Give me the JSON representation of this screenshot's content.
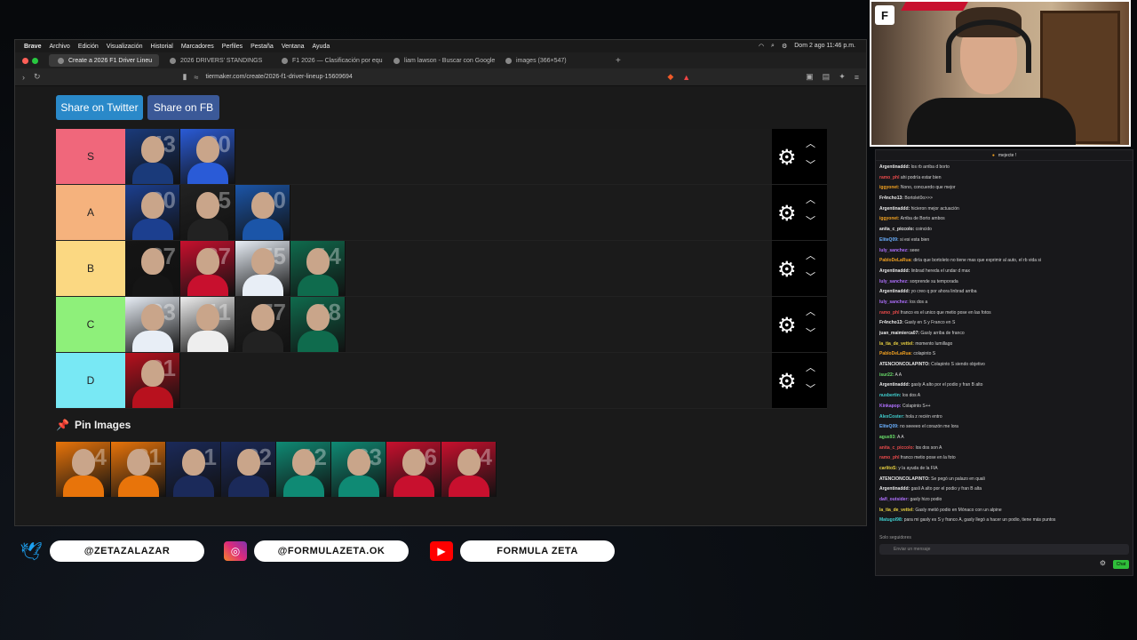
{
  "menubar": {
    "items": [
      "Brave",
      "Archivo",
      "Edición",
      "Visualización",
      "Historial",
      "Marcadores",
      "Perfiles",
      "Pestaña",
      "Ventana",
      "Ayuda"
    ],
    "clock": "Dom 2 ago 11:46 p.m."
  },
  "tabs": [
    {
      "label": "Create a 2026 F1 Driver Lineu"
    },
    {
      "label": "2026 DRIVERS' STANDINGS"
    },
    {
      "label": "F1 2026 — Clasificación por equip"
    },
    {
      "label": "liam lawson - Buscar con Google"
    },
    {
      "label": "images (366×547)"
    }
  ],
  "address": {
    "url": "tiermaker.com/create/2026-f1-driver-lineup-15609694"
  },
  "share": {
    "twitter": "Share on Twitter",
    "facebook": "Share on FB"
  },
  "tiers": [
    {
      "label": "S",
      "color": "#f0677b",
      "drivers": [
        {
          "num": "43",
          "kit": "#1a3a7a"
        },
        {
          "num": "30",
          "kit": "#2a5bd7"
        }
      ]
    },
    {
      "label": "A",
      "color": "#f5b27d",
      "drivers": [
        {
          "num": "30",
          "kit": "#1c3f8f"
        },
        {
          "num": "5",
          "kit": "#222"
        },
        {
          "num": "10",
          "kit": "#1b55a8"
        }
      ]
    },
    {
      "label": "B",
      "color": "#fbd882",
      "drivers": [
        {
          "num": "27",
          "kit": "#151515"
        },
        {
          "num": "87",
          "kit": "#c8102e"
        },
        {
          "num": "55",
          "kit": "#e8eef6"
        },
        {
          "num": "14",
          "kit": "#0f6b4d"
        }
      ]
    },
    {
      "label": "C",
      "color": "#8ef07a",
      "drivers": [
        {
          "num": "23",
          "kit": "#e8eef6"
        },
        {
          "num": "11",
          "kit": "#eeeeee"
        },
        {
          "num": "77",
          "kit": "#222"
        },
        {
          "num": "18",
          "kit": "#0f6b4d"
        }
      ]
    },
    {
      "label": "D",
      "color": "#78e8f4",
      "drivers": [
        {
          "num": "31",
          "kit": "#b8111e"
        }
      ]
    }
  ],
  "pin": {
    "title": "Pin Images"
  },
  "pin_images": [
    {
      "num": "4",
      "kit": "#e8740a"
    },
    {
      "num": "81",
      "kit": "#e8740a"
    },
    {
      "num": "1",
      "kit": "#1b2a5a"
    },
    {
      "num": "22",
      "kit": "#1b2a5a"
    },
    {
      "num": "12",
      "kit": "#0f8a74"
    },
    {
      "num": "63",
      "kit": "#0f8a74"
    },
    {
      "num": "16",
      "kit": "#c8102e"
    },
    {
      "num": "44",
      "kit": "#c8102e"
    }
  ],
  "chat": {
    "pinned": "mejecte !",
    "messages": [
      {
        "user": "Argentinaddd:",
        "color": "#e8e8e8",
        "text": "los rb arriba d borto"
      },
      {
        "user": "ramo_phl",
        "color": "#e84a4a",
        "text": "ahi podría estar bien"
      },
      {
        "user": "iggyonet:",
        "color": "#f0a020",
        "text": "Nono, concuerdo que mejor"
      },
      {
        "user": "Fr4ncho13:",
        "color": "#e8e8e8",
        "text": "Bortolet0o>>>"
      },
      {
        "user": "Argentinaddd:",
        "color": "#e8e8e8",
        "text": "hicieron mejor actuación"
      },
      {
        "user": "iggyonet:",
        "color": "#f0a020",
        "text": "Arriba de Borto ambos"
      },
      {
        "user": "anita_c_piccolo:",
        "color": "#e8e8e8",
        "text": "coincido"
      },
      {
        "user": "EliteQ09:",
        "color": "#6ab0ff",
        "text": "si esi esta bien"
      },
      {
        "user": "luly_sanchez:",
        "color": "#b070ff",
        "text": "seee"
      },
      {
        "user": "PabloDeLaRua:",
        "color": "#f0a020",
        "text": "diría que bortoleto no tiene mas que exprimir al auto, el rb vida si"
      },
      {
        "user": "Argentinaddd:",
        "color": "#e8e8e8",
        "text": "linbrad hereda el undar d max"
      },
      {
        "user": "luly_sanchez:",
        "color": "#b070ff",
        "text": "sorprende su temporada"
      },
      {
        "user": "Argentinaddd:",
        "color": "#e8e8e8",
        "text": "yo creo q por ahora linbrad arriba"
      },
      {
        "user": "luly_sanchez:",
        "color": "#b070ff",
        "text": "los dos a"
      },
      {
        "user": "ramo_phl",
        "color": "#e84a4a",
        "text": "franco es el unico que metio pose en las fotos"
      },
      {
        "user": "Fr4ncho13:",
        "color": "#e8e8e8",
        "text": "Gasly en S y Franco en S"
      },
      {
        "user": "juan_maimierca07:",
        "color": "#e8e8e8",
        "text": "Gasly arriba de franco"
      },
      {
        "user": "la_tia_de_vettel:",
        "color": "#e8d040",
        "text": "momento lumillago"
      },
      {
        "user": "PabloDeLaRua:",
        "color": "#f0a020",
        "text": "colapinto S"
      },
      {
        "user": "ATENCIONCOLAPINTO:",
        "color": "#e8e8e8",
        "text": "Colapinto S siendo objetivo"
      },
      {
        "user": "isur22:",
        "color": "#6ae06a",
        "text": "A A"
      },
      {
        "user": "Argentinaddd:",
        "color": "#e8e8e8",
        "text": "gasly A alto por el podio y fran B alto"
      },
      {
        "user": "nusbertin:",
        "color": "#40d0d0",
        "text": "los dos A"
      },
      {
        "user": "Kinkapop:",
        "color": "#b070ff",
        "text": "Colapinto S++"
      },
      {
        "user": "AlexCoster:",
        "color": "#40d0d0",
        "text": "hola z recién entro"
      },
      {
        "user": "EliteQ09:",
        "color": "#6ab0ff",
        "text": "no seeeeo el corazón me lora"
      },
      {
        "user": "agus93:",
        "color": "#6ae06a",
        "text": "A A"
      },
      {
        "user": "anita_c_piccolo:",
        "color": "#e84a4a",
        "text": "los dos son A"
      },
      {
        "user": "ramo_phl",
        "color": "#e84a4a",
        "text": "franco metio pose en la foto"
      },
      {
        "user": "carlitoS:",
        "color": "#e8d040",
        "text": "y la ayuda de la FIA"
      },
      {
        "user": "ATENCIONCOLAPINTO:",
        "color": "#e8e8e8",
        "text": "Se pegó un palazo en quali"
      },
      {
        "user": "Argentinaddd:",
        "color": "#e8e8e8",
        "text": "gasli A alto por el podio y fran B alta"
      },
      {
        "user": "dafi_outsider:",
        "color": "#b070ff",
        "text": "gasly hizo podio"
      },
      {
        "user": "la_tia_de_vettel:",
        "color": "#e8d040",
        "text": "Gasly metió podio en Mónaco con un alpine"
      },
      {
        "user": "Matugol98:",
        "color": "#40d0d0",
        "text": "para mi gasly es S y franco A, gasly llegó a hacer un podio, tiene más puntos"
      }
    ],
    "followers_note": "Solo seguidores",
    "input_placeholder": "Enviar un mensaje",
    "send_label": "Chat"
  },
  "social": {
    "twitter_handle": "@ZETAZALAZAR",
    "instagram_handle": "@FORMULAZETA.OK",
    "youtube_channel": "FORMULA ZETA"
  },
  "colors": {
    "twitter": "#1da1f2",
    "instagram": "#d6249f",
    "youtube": "#ff0000"
  }
}
